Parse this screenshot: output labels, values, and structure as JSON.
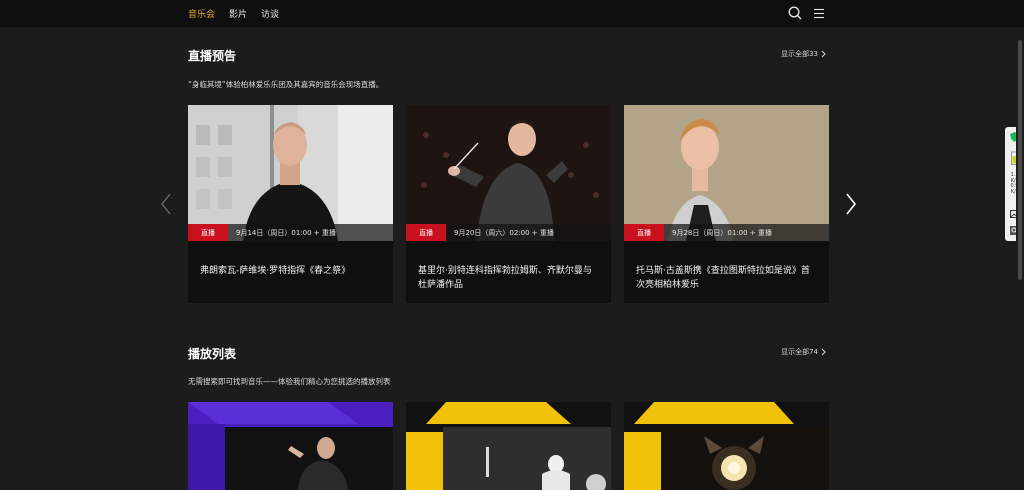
{
  "nav": {
    "items": [
      {
        "label": "音乐会",
        "active": true
      },
      {
        "label": "影片",
        "active": false
      },
      {
        "label": "访谈",
        "active": false
      }
    ],
    "icons": [
      "search-icon",
      "menu-icon"
    ]
  },
  "live": {
    "title": "直播预告",
    "show_all": "显示全部33",
    "subtitle": "“身临其境”体验柏林爱乐乐团及其嘉宾的音乐会现场直播。",
    "cards": [
      {
        "badge": "直播",
        "time": "9月14日（周日）01:00 + 重播",
        "title": "弗朗索瓦-萨维埃·罗特指挥《春之祭》"
      },
      {
        "badge": "直播",
        "time": "9月20日（周六）02:00 + 重播",
        "title": "基里尔·别特连科指挥勃拉姆斯、齐默尔曼与杜萨潘作品"
      },
      {
        "badge": "直播",
        "time": "9月28日（周日）01:00 + 重播",
        "title": "托马斯·古盖斯携《查拉图斯特拉如是说》首次亮相柏林爱乐"
      }
    ]
  },
  "playlists": {
    "title": "播放列表",
    "show_all": "显示全部74",
    "subtitle": "无需搜索即可找到音乐——体验我们精心为您挑选的播放列表"
  },
  "extension": {
    "stat1_value": "1.3",
    "stat1_unit": "K/s",
    "stat2_value": "0.9",
    "stat2_unit": "K/s"
  },
  "colors": {
    "accent": "#d7a821",
    "live_red": "#c8101e",
    "background": "#1c1c1c",
    "topbar": "#0f0f0f"
  }
}
